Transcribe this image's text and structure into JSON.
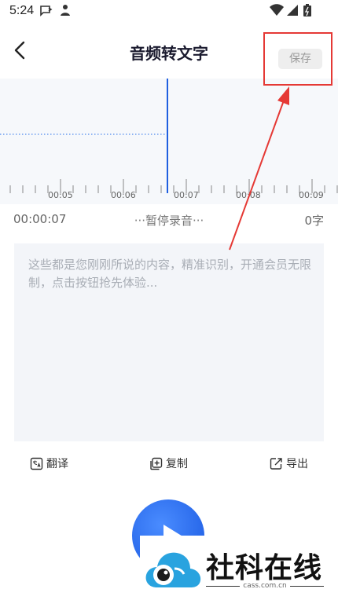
{
  "status": {
    "time": "5:24"
  },
  "header": {
    "title": "音频转文字",
    "save_label": "保存"
  },
  "waveform": {
    "ticks": [
      "00:05",
      "00:06",
      "00:07",
      "00:08",
      "00:09"
    ]
  },
  "timer": {
    "elapsed": "00:00:07",
    "state": "···暂停录音···",
    "char_count": "0字"
  },
  "transcript": {
    "placeholder": "这些都是您刚刚所说的内容，精准识别，开通会员无限制，点击按钮抢先体验..."
  },
  "actions": {
    "translate": "翻译",
    "copy": "复制",
    "export": "导出"
  },
  "watermark": {
    "name": "社科在线",
    "domain": "cass.com.cn"
  },
  "colors": {
    "accent": "#1f5fe0",
    "annotation": "#e53935"
  }
}
